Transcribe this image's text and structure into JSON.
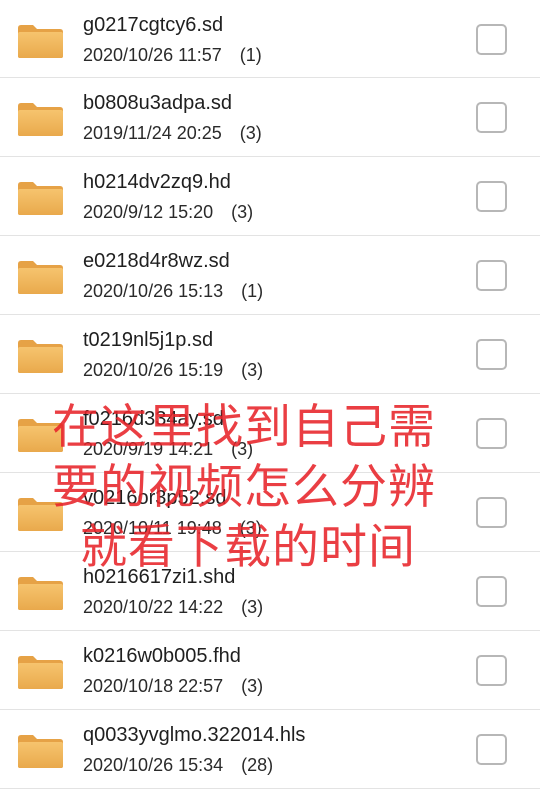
{
  "colors": {
    "overlay_text": "#e8242a",
    "folder": "#f0b45a",
    "divider": "#e3e3e3"
  },
  "items": [
    {
      "name": "g0217cgtcy6.sd",
      "date": "2020/10/26 11:57",
      "count": "(1)",
      "icon": "folder-icon"
    },
    {
      "name": "b0808u3adpa.sd",
      "date": "2019/11/24 20:25",
      "count": "(3)",
      "icon": "folder-icon"
    },
    {
      "name": "h0214dv2zq9.hd",
      "date": "2020/9/12 15:20",
      "count": "(3)",
      "icon": "folder-icon"
    },
    {
      "name": "e0218d4r8wz.sd",
      "date": "2020/10/26 15:13",
      "count": "(1)",
      "icon": "folder-icon"
    },
    {
      "name": "t0219nl5j1p.sd",
      "date": "2020/10/26 15:19",
      "count": "(3)",
      "icon": "folder-icon"
    },
    {
      "name": "f0216d334ay.sd",
      "date": "2020/9/19 14:21",
      "count": "(3)",
      "icon": "folder-icon"
    },
    {
      "name": "v0216or3p52.sd",
      "date": "2020/10/11 19:48",
      "count": "(3)",
      "icon": "folder-icon"
    },
    {
      "name": "h0216617zi1.shd",
      "date": "2020/10/22 14:22",
      "count": "(3)",
      "icon": "folder-icon"
    },
    {
      "name": "k0216w0b005.fhd",
      "date": "2020/10/18 22:57",
      "count": "(3)",
      "icon": "folder-icon"
    },
    {
      "name": "q0033yvglmo.322014.hls",
      "date": "2020/10/26 15:34",
      "count": "(28)",
      "icon": "folder-icon"
    }
  ],
  "overlay": {
    "lines": [
      "在这里找到自己需",
      "要的视频怎么分辨",
      "就看下载的时间"
    ]
  }
}
